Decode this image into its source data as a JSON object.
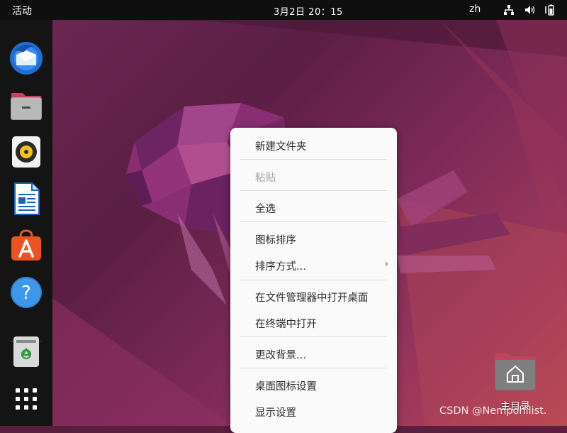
{
  "top_bar": {
    "activities": "活动",
    "clock": "3月2日  20：15",
    "input_language": "zh"
  },
  "dock": {
    "apps": [
      {
        "name": "thunderbird-icon"
      },
      {
        "name": "files-icon"
      },
      {
        "name": "rhythmbox-icon"
      },
      {
        "name": "libreoffice-writer-icon"
      },
      {
        "name": "ubuntu-software-icon"
      },
      {
        "name": "help-icon"
      },
      {
        "name": "trash-icon"
      },
      {
        "name": "show-apps-grid-icon"
      }
    ]
  },
  "context_menu": {
    "items": [
      {
        "label": "新建文件夹",
        "enabled": true
      },
      {
        "label": "粘贴",
        "enabled": false
      },
      {
        "label": "全选",
        "enabled": true
      },
      {
        "label": "图标排序",
        "enabled": true
      },
      {
        "label": "排序方式...",
        "enabled": true,
        "has_submenu": true
      },
      {
        "label": "在文件管理器中打开桌面",
        "enabled": true
      },
      {
        "label": "在终端中打开",
        "enabled": true
      },
      {
        "label": "更改背景...",
        "enabled": true
      },
      {
        "label": "桌面图标设置",
        "enabled": true
      },
      {
        "label": "显示设置",
        "enabled": true
      }
    ],
    "submenu_arrow": "›"
  },
  "desktop": {
    "home_folder_label": "主目录"
  },
  "watermark": "CSDN @Nempohilist.",
  "colors": {
    "top_bar": "#0f0f0f",
    "dock": "#141414",
    "menu_bg": "#fafafa",
    "wallpaper_accent": "#7d2a58"
  }
}
